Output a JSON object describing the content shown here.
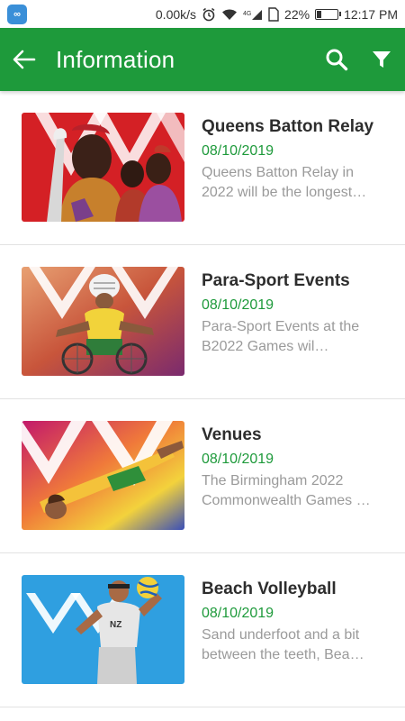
{
  "status_bar": {
    "speed": "0.00k/s",
    "network": "4G",
    "battery_percent": "22%",
    "battery_level": 0.22,
    "time": "12:17 PM"
  },
  "app_bar": {
    "title": "Information",
    "back_icon": "arrow-left-icon",
    "search_icon": "search-icon",
    "filter_icon": "filter-icon",
    "color": "#1e9a3b"
  },
  "items": [
    {
      "title": "Queens Batton Relay",
      "date": "08/10/2019",
      "description": "Queens Batton Relay in 2022 will be the longest…",
      "image": "queens-baton-relay-image"
    },
    {
      "title": "Para-Sport Events",
      "date": "08/10/2019",
      "description": "Para-Sport Events at the B2022 Games wil…",
      "image": "para-sport-image"
    },
    {
      "title": "Venues",
      "date": "08/10/2019",
      "description": "The Birmingham 2022 Commonwealth Games …",
      "image": "venues-image"
    },
    {
      "title": "Beach Volleyball",
      "date": "08/10/2019",
      "description": "Sand underfoot and a bit between the teeth, Bea…",
      "image": "beach-volleyball-image"
    }
  ]
}
